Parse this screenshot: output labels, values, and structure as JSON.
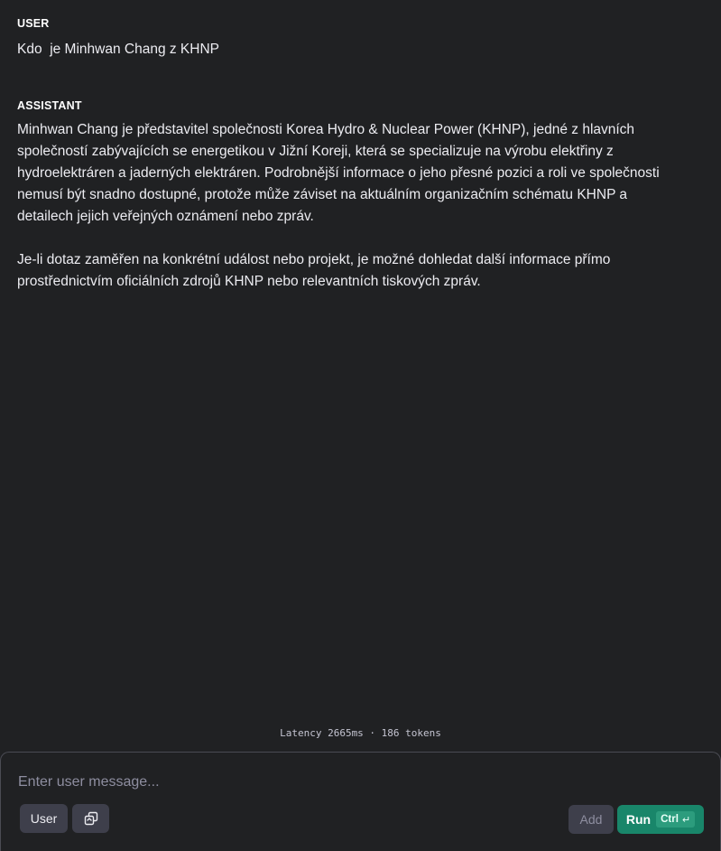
{
  "messages": [
    {
      "role": "USER",
      "text": "Kdo  je Minhwan Chang z KHNP"
    },
    {
      "role": "ASSISTANT",
      "paragraphs": [
        "Minhwan Chang je představitel společnosti Korea Hydro & Nuclear Power (KHNP), jedné z hlavních společností zabývajících se energetikou v Jižní Koreji, která se specializuje na výrobu elektřiny z hydroelektráren a jaderných elektráren. Podrobnější informace o jeho přesné pozici a roli ve společnosti nemusí být snadno dostupné, protože může záviset na aktuálním organizačním schématu KHNP a detailech jejich veřejných oznámení nebo zpráv.",
        "Je-li dotaz zaměřen na konkrétní událost nebo projekt, je možné dohledat další informace přímo prostřednictvím oficiálních zdrojů KHNP nebo relevantních tiskových zpráv."
      ]
    }
  ],
  "status": {
    "latency": "Latency 2665ms · 186 tokens"
  },
  "composer": {
    "placeholder": "Enter user message...",
    "value": "",
    "role_button": "User",
    "role_icon": "swap-role-icon",
    "add_label": "Add",
    "run_label": "Run",
    "shortcut_label": "Ctrl",
    "shortcut_icon": "enter-key-icon"
  },
  "colors": {
    "background": "#202123",
    "text": "#ececf1",
    "button_bg": "#3e3f4b",
    "run_bg": "#19866a",
    "border": "#4a4b53"
  }
}
